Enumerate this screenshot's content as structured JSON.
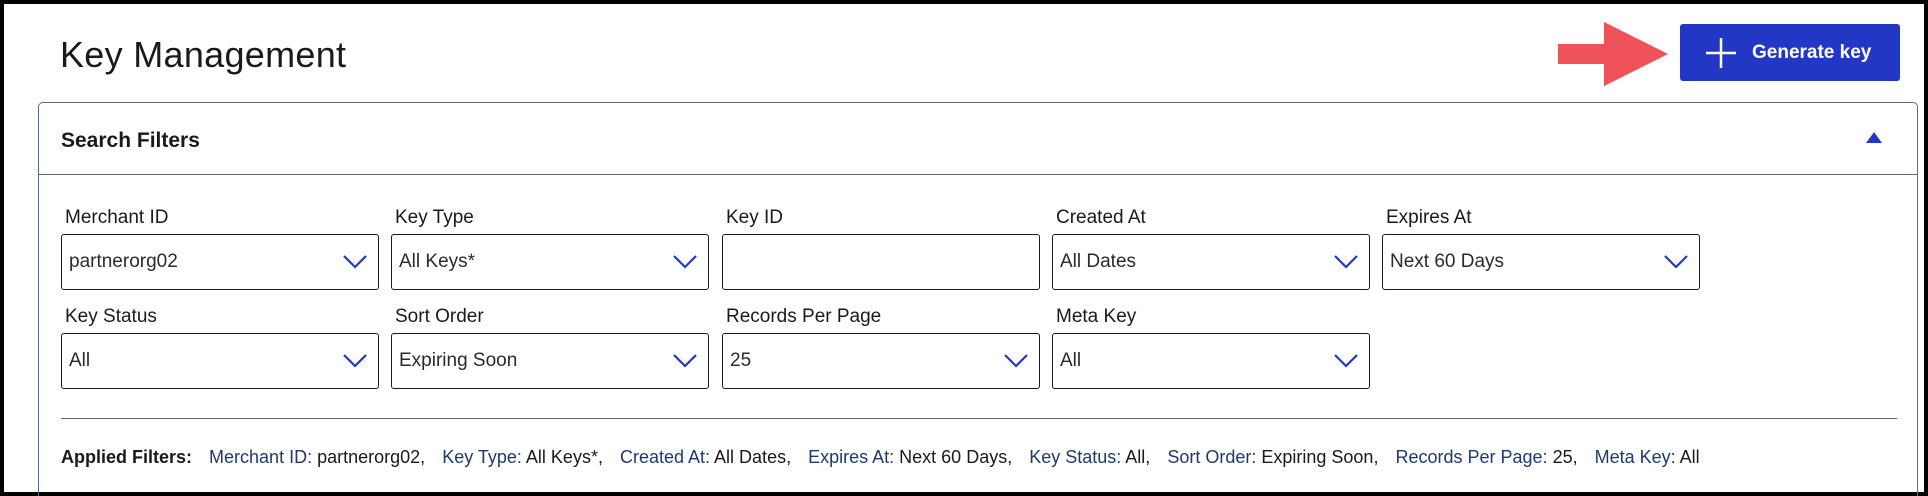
{
  "page": {
    "title": "Key Management"
  },
  "header": {
    "generate_button_label": "Generate key",
    "arrow_color": "#f0525a",
    "button_color": "#2238c4"
  },
  "filters_panel": {
    "title": "Search Filters",
    "fields": {
      "merchant_id": {
        "label": "Merchant ID",
        "value": "partnerorg02"
      },
      "key_type": {
        "label": "Key Type",
        "value": "All Keys*"
      },
      "key_id": {
        "label": "Key ID",
        "value": ""
      },
      "created_at": {
        "label": "Created At",
        "value": "All Dates"
      },
      "expires_at": {
        "label": "Expires At",
        "value": "Next 60 Days"
      },
      "key_status": {
        "label": "Key Status",
        "value": "All"
      },
      "sort_order": {
        "label": "Sort Order",
        "value": "Expiring Soon"
      },
      "records_per_page": {
        "label": "Records Per Page",
        "value": "25"
      },
      "meta_key": {
        "label": "Meta Key",
        "value": "All"
      }
    },
    "applied": {
      "heading": "Applied Filters:",
      "items": [
        {
          "key": "Merchant ID:",
          "value": "partnerorg02,"
        },
        {
          "key": "Key Type:",
          "value": "All Keys*,"
        },
        {
          "key": "Created At:",
          "value": "All Dates,"
        },
        {
          "key": "Expires At:",
          "value": "Next 60 Days,"
        },
        {
          "key": "Key Status:",
          "value": "All,"
        },
        {
          "key": "Sort Order:",
          "value": "Expiring Soon,"
        },
        {
          "key": "Records Per Page:",
          "value": "25,"
        },
        {
          "key": "Meta Key:",
          "value": "All"
        }
      ]
    }
  }
}
